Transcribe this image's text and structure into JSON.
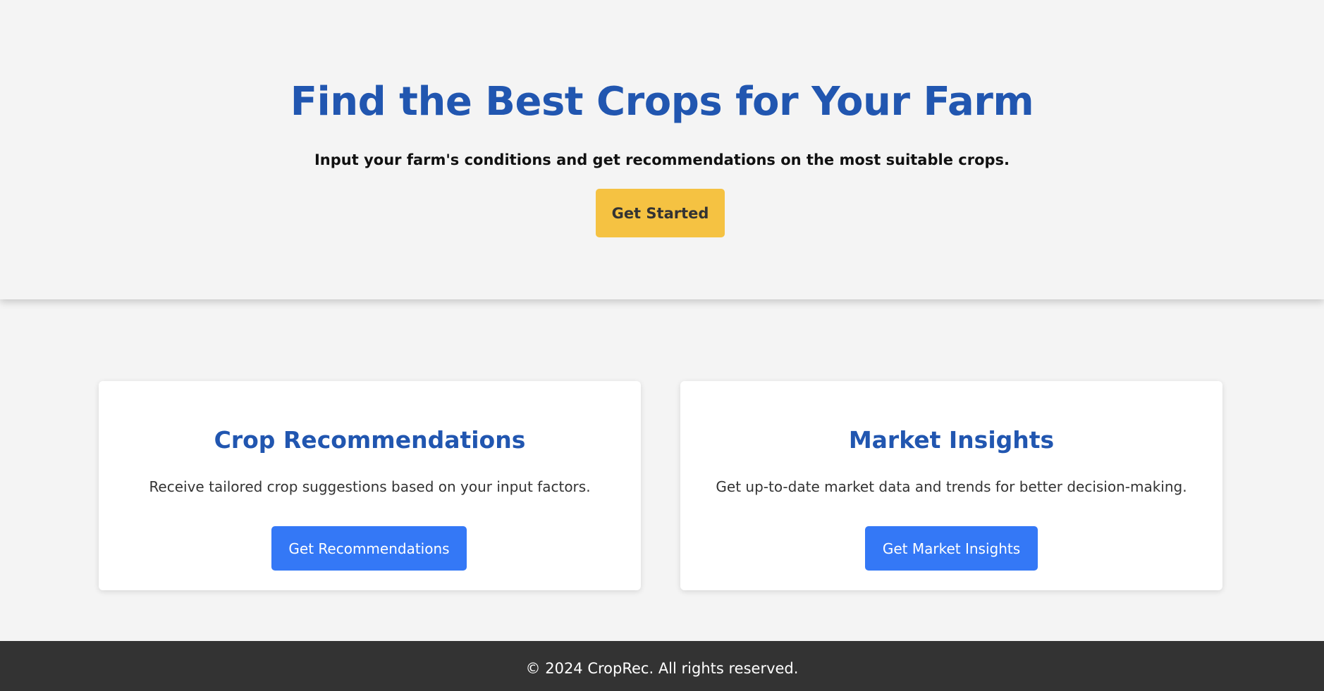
{
  "hero": {
    "title": "Find the Best Crops for Your Farm",
    "subtitle": "Input your farm's conditions and get recommendations on the most suitable crops.",
    "cta_label": "Get Started"
  },
  "cards": [
    {
      "title": "Crop Recommendations",
      "text": "Receive tailored crop suggestions based on your input factors.",
      "button_label": "Get Recommendations"
    },
    {
      "title": "Market Insights",
      "text": "Get up-to-date market data and trends for better decision-making.",
      "button_label": "Get Market Insights"
    }
  ],
  "footer": {
    "copyright": "© 2024 CropRec. All rights reserved."
  },
  "colors": {
    "brand_blue": "#2156b0",
    "button_blue": "#3478f6",
    "accent_yellow": "#f5c242",
    "footer_bg": "#333333",
    "page_bg": "#f4f4f4"
  }
}
